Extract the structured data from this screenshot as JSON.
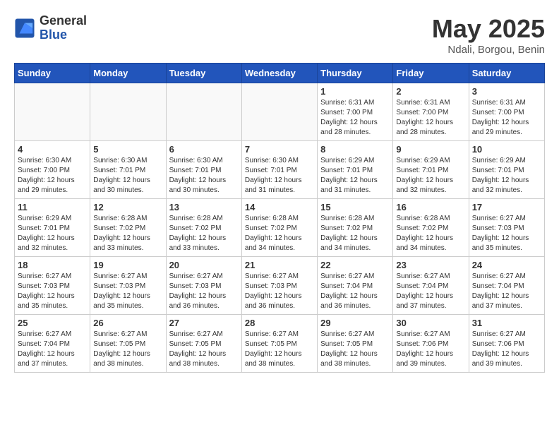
{
  "header": {
    "logo_general": "General",
    "logo_blue": "Blue",
    "month_title": "May 2025",
    "location": "Ndali, Borgou, Benin"
  },
  "days_of_week": [
    "Sunday",
    "Monday",
    "Tuesday",
    "Wednesday",
    "Thursday",
    "Friday",
    "Saturday"
  ],
  "weeks": [
    [
      {
        "day": "",
        "info": ""
      },
      {
        "day": "",
        "info": ""
      },
      {
        "day": "",
        "info": ""
      },
      {
        "day": "",
        "info": ""
      },
      {
        "day": "1",
        "info": "Sunrise: 6:31 AM\nSunset: 7:00 PM\nDaylight: 12 hours\nand 28 minutes."
      },
      {
        "day": "2",
        "info": "Sunrise: 6:31 AM\nSunset: 7:00 PM\nDaylight: 12 hours\nand 28 minutes."
      },
      {
        "day": "3",
        "info": "Sunrise: 6:31 AM\nSunset: 7:00 PM\nDaylight: 12 hours\nand 29 minutes."
      }
    ],
    [
      {
        "day": "4",
        "info": "Sunrise: 6:30 AM\nSunset: 7:00 PM\nDaylight: 12 hours\nand 29 minutes."
      },
      {
        "day": "5",
        "info": "Sunrise: 6:30 AM\nSunset: 7:01 PM\nDaylight: 12 hours\nand 30 minutes."
      },
      {
        "day": "6",
        "info": "Sunrise: 6:30 AM\nSunset: 7:01 PM\nDaylight: 12 hours\nand 30 minutes."
      },
      {
        "day": "7",
        "info": "Sunrise: 6:30 AM\nSunset: 7:01 PM\nDaylight: 12 hours\nand 31 minutes."
      },
      {
        "day": "8",
        "info": "Sunrise: 6:29 AM\nSunset: 7:01 PM\nDaylight: 12 hours\nand 31 minutes."
      },
      {
        "day": "9",
        "info": "Sunrise: 6:29 AM\nSunset: 7:01 PM\nDaylight: 12 hours\nand 32 minutes."
      },
      {
        "day": "10",
        "info": "Sunrise: 6:29 AM\nSunset: 7:01 PM\nDaylight: 12 hours\nand 32 minutes."
      }
    ],
    [
      {
        "day": "11",
        "info": "Sunrise: 6:29 AM\nSunset: 7:01 PM\nDaylight: 12 hours\nand 32 minutes."
      },
      {
        "day": "12",
        "info": "Sunrise: 6:28 AM\nSunset: 7:02 PM\nDaylight: 12 hours\nand 33 minutes."
      },
      {
        "day": "13",
        "info": "Sunrise: 6:28 AM\nSunset: 7:02 PM\nDaylight: 12 hours\nand 33 minutes."
      },
      {
        "day": "14",
        "info": "Sunrise: 6:28 AM\nSunset: 7:02 PM\nDaylight: 12 hours\nand 34 minutes."
      },
      {
        "day": "15",
        "info": "Sunrise: 6:28 AM\nSunset: 7:02 PM\nDaylight: 12 hours\nand 34 minutes."
      },
      {
        "day": "16",
        "info": "Sunrise: 6:28 AM\nSunset: 7:02 PM\nDaylight: 12 hours\nand 34 minutes."
      },
      {
        "day": "17",
        "info": "Sunrise: 6:27 AM\nSunset: 7:03 PM\nDaylight: 12 hours\nand 35 minutes."
      }
    ],
    [
      {
        "day": "18",
        "info": "Sunrise: 6:27 AM\nSunset: 7:03 PM\nDaylight: 12 hours\nand 35 minutes."
      },
      {
        "day": "19",
        "info": "Sunrise: 6:27 AM\nSunset: 7:03 PM\nDaylight: 12 hours\nand 35 minutes."
      },
      {
        "day": "20",
        "info": "Sunrise: 6:27 AM\nSunset: 7:03 PM\nDaylight: 12 hours\nand 36 minutes."
      },
      {
        "day": "21",
        "info": "Sunrise: 6:27 AM\nSunset: 7:03 PM\nDaylight: 12 hours\nand 36 minutes."
      },
      {
        "day": "22",
        "info": "Sunrise: 6:27 AM\nSunset: 7:04 PM\nDaylight: 12 hours\nand 36 minutes."
      },
      {
        "day": "23",
        "info": "Sunrise: 6:27 AM\nSunset: 7:04 PM\nDaylight: 12 hours\nand 37 minutes."
      },
      {
        "day": "24",
        "info": "Sunrise: 6:27 AM\nSunset: 7:04 PM\nDaylight: 12 hours\nand 37 minutes."
      }
    ],
    [
      {
        "day": "25",
        "info": "Sunrise: 6:27 AM\nSunset: 7:04 PM\nDaylight: 12 hours\nand 37 minutes."
      },
      {
        "day": "26",
        "info": "Sunrise: 6:27 AM\nSunset: 7:05 PM\nDaylight: 12 hours\nand 38 minutes."
      },
      {
        "day": "27",
        "info": "Sunrise: 6:27 AM\nSunset: 7:05 PM\nDaylight: 12 hours\nand 38 minutes."
      },
      {
        "day": "28",
        "info": "Sunrise: 6:27 AM\nSunset: 7:05 PM\nDaylight: 12 hours\nand 38 minutes."
      },
      {
        "day": "29",
        "info": "Sunrise: 6:27 AM\nSunset: 7:05 PM\nDaylight: 12 hours\nand 38 minutes."
      },
      {
        "day": "30",
        "info": "Sunrise: 6:27 AM\nSunset: 7:06 PM\nDaylight: 12 hours\nand 39 minutes."
      },
      {
        "day": "31",
        "info": "Sunrise: 6:27 AM\nSunset: 7:06 PM\nDaylight: 12 hours\nand 39 minutes."
      }
    ]
  ]
}
